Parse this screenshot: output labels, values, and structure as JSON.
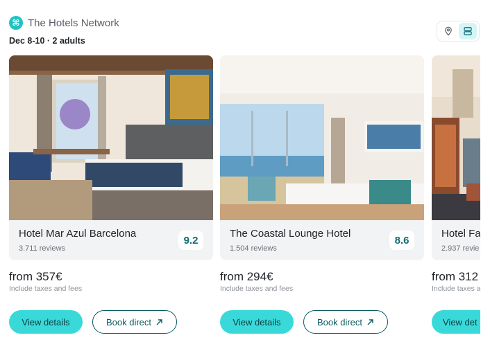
{
  "header": {
    "brand_icon": "⌘",
    "brand_name": "The Hotels Network",
    "dates": "Dec 8-10 · 2 adults"
  },
  "view_toggle": {
    "options": [
      {
        "icon": "map-pin-icon",
        "active": false
      },
      {
        "icon": "list-view-icon",
        "active": true
      }
    ]
  },
  "colors": {
    "accent": "#3ad9d9",
    "rating_text": "#0b6e72",
    "secondary_border": "#0b5a62"
  },
  "hotels": [
    {
      "name": "Hotel Mar Azul Barcelona",
      "reviews": "3.711 reviews",
      "rating": "9.2",
      "price": "from 357€",
      "tax_note": "Include taxes and fees",
      "primary_action": "View details",
      "secondary_action": "Book direct"
    },
    {
      "name": "The Coastal Lounge Hotel",
      "reviews": "1.504 reviews",
      "rating": "8.6",
      "price": "from 294€",
      "tax_note": "Include taxes and fees",
      "primary_action": "View details",
      "secondary_action": "Book direct"
    },
    {
      "name": "Hotel Fa",
      "reviews": "2.937 revie",
      "price": "from 312",
      "tax_note": "Include taxes a",
      "primary_action": "View det"
    }
  ]
}
